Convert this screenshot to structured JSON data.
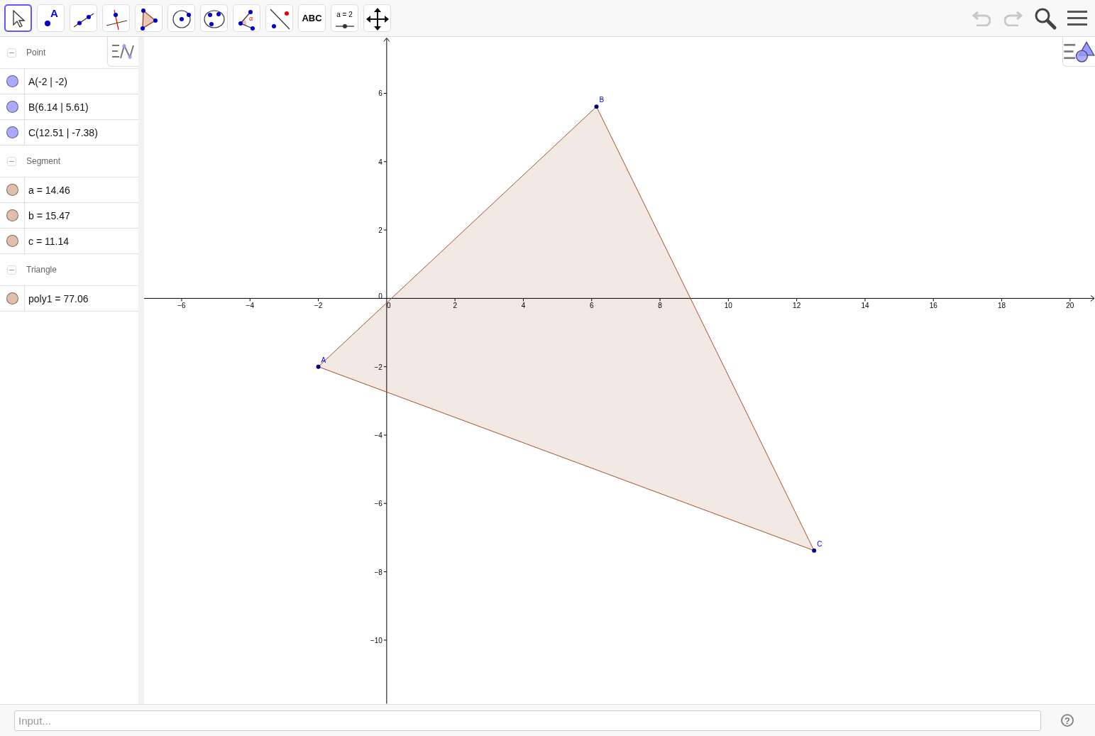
{
  "toolbar": {
    "tools": [
      {
        "kind": "move",
        "selected": true
      },
      {
        "kind": "point",
        "label": "A",
        "selected": false
      },
      {
        "kind": "line",
        "selected": false
      },
      {
        "kind": "perpendicular",
        "selected": false
      },
      {
        "kind": "polygon",
        "selected": false
      },
      {
        "kind": "circle",
        "selected": false
      },
      {
        "kind": "conic",
        "selected": false
      },
      {
        "kind": "angle",
        "label": "α",
        "selected": false
      },
      {
        "kind": "reflect",
        "selected": false
      },
      {
        "kind": "text",
        "label": "ABC",
        "selected": false
      },
      {
        "kind": "slider",
        "label": "a = 2",
        "selected": false
      },
      {
        "kind": "pan",
        "selected": false
      }
    ],
    "undo": {
      "disabled": true
    },
    "redo": {
      "disabled": true
    }
  },
  "algebra": {
    "groups": [
      {
        "title": "Point",
        "expanded": true,
        "items": [
          {
            "text": "A(-2 | -2)",
            "color": "#aaaaff"
          },
          {
            "text": "B(6.14 | 5.61)",
            "color": "#aaaaff"
          },
          {
            "text": "C(12.51 | -7.38)",
            "color": "#aaaaff"
          }
        ]
      },
      {
        "title": "Segment",
        "expanded": true,
        "items": [
          {
            "text": "a = 14.46",
            "color": "#e0c0ac"
          },
          {
            "text": "b = 15.47",
            "color": "#e0c0ac"
          },
          {
            "text": "c = 11.14",
            "color": "#e0c0ac"
          }
        ]
      },
      {
        "title": "Triangle",
        "expanded": true,
        "items": [
          {
            "text": "poly1 = 77.06",
            "color": "#e0c0ac"
          }
        ]
      }
    ]
  },
  "graphics": {
    "chart_data": {
      "type": "scatter",
      "x": [
        -2,
        6.14,
        12.51
      ],
      "series": [
        {
          "color": "#00007f",
          "values": [
            -2,
            5.61,
            -7.38
          ]
        }
      ],
      "xlim": [
        -7.1,
        20.73
      ],
      "ylim": [
        -11.86,
        7.64
      ],
      "xticks": [
        {
          "value": -6,
          "label": "−6"
        },
        {
          "value": -4,
          "label": "−4"
        },
        {
          "value": -2,
          "label": "−2"
        },
        0,
        2,
        4,
        6,
        8,
        10,
        12,
        14,
        16,
        18,
        20
      ],
      "yticks": [
        {
          "value": -10,
          "label": "−10"
        },
        {
          "value": -8,
          "label": "−8"
        },
        {
          "value": -6,
          "label": "−6"
        },
        {
          "value": -4,
          "label": "−4"
        },
        {
          "value": -2,
          "label": "−2"
        },
        0,
        2,
        4,
        6
      ],
      "annotations": [
        {
          "x": -2,
          "y": -2,
          "text": "A"
        },
        {
          "x": 6.14,
          "y": 5.61,
          "text": "B"
        },
        {
          "x": 12.51,
          "y": -7.38,
          "text": "C"
        }
      ]
    }
  },
  "input_bar": {
    "placeholder": "Input...",
    "help": "?"
  }
}
